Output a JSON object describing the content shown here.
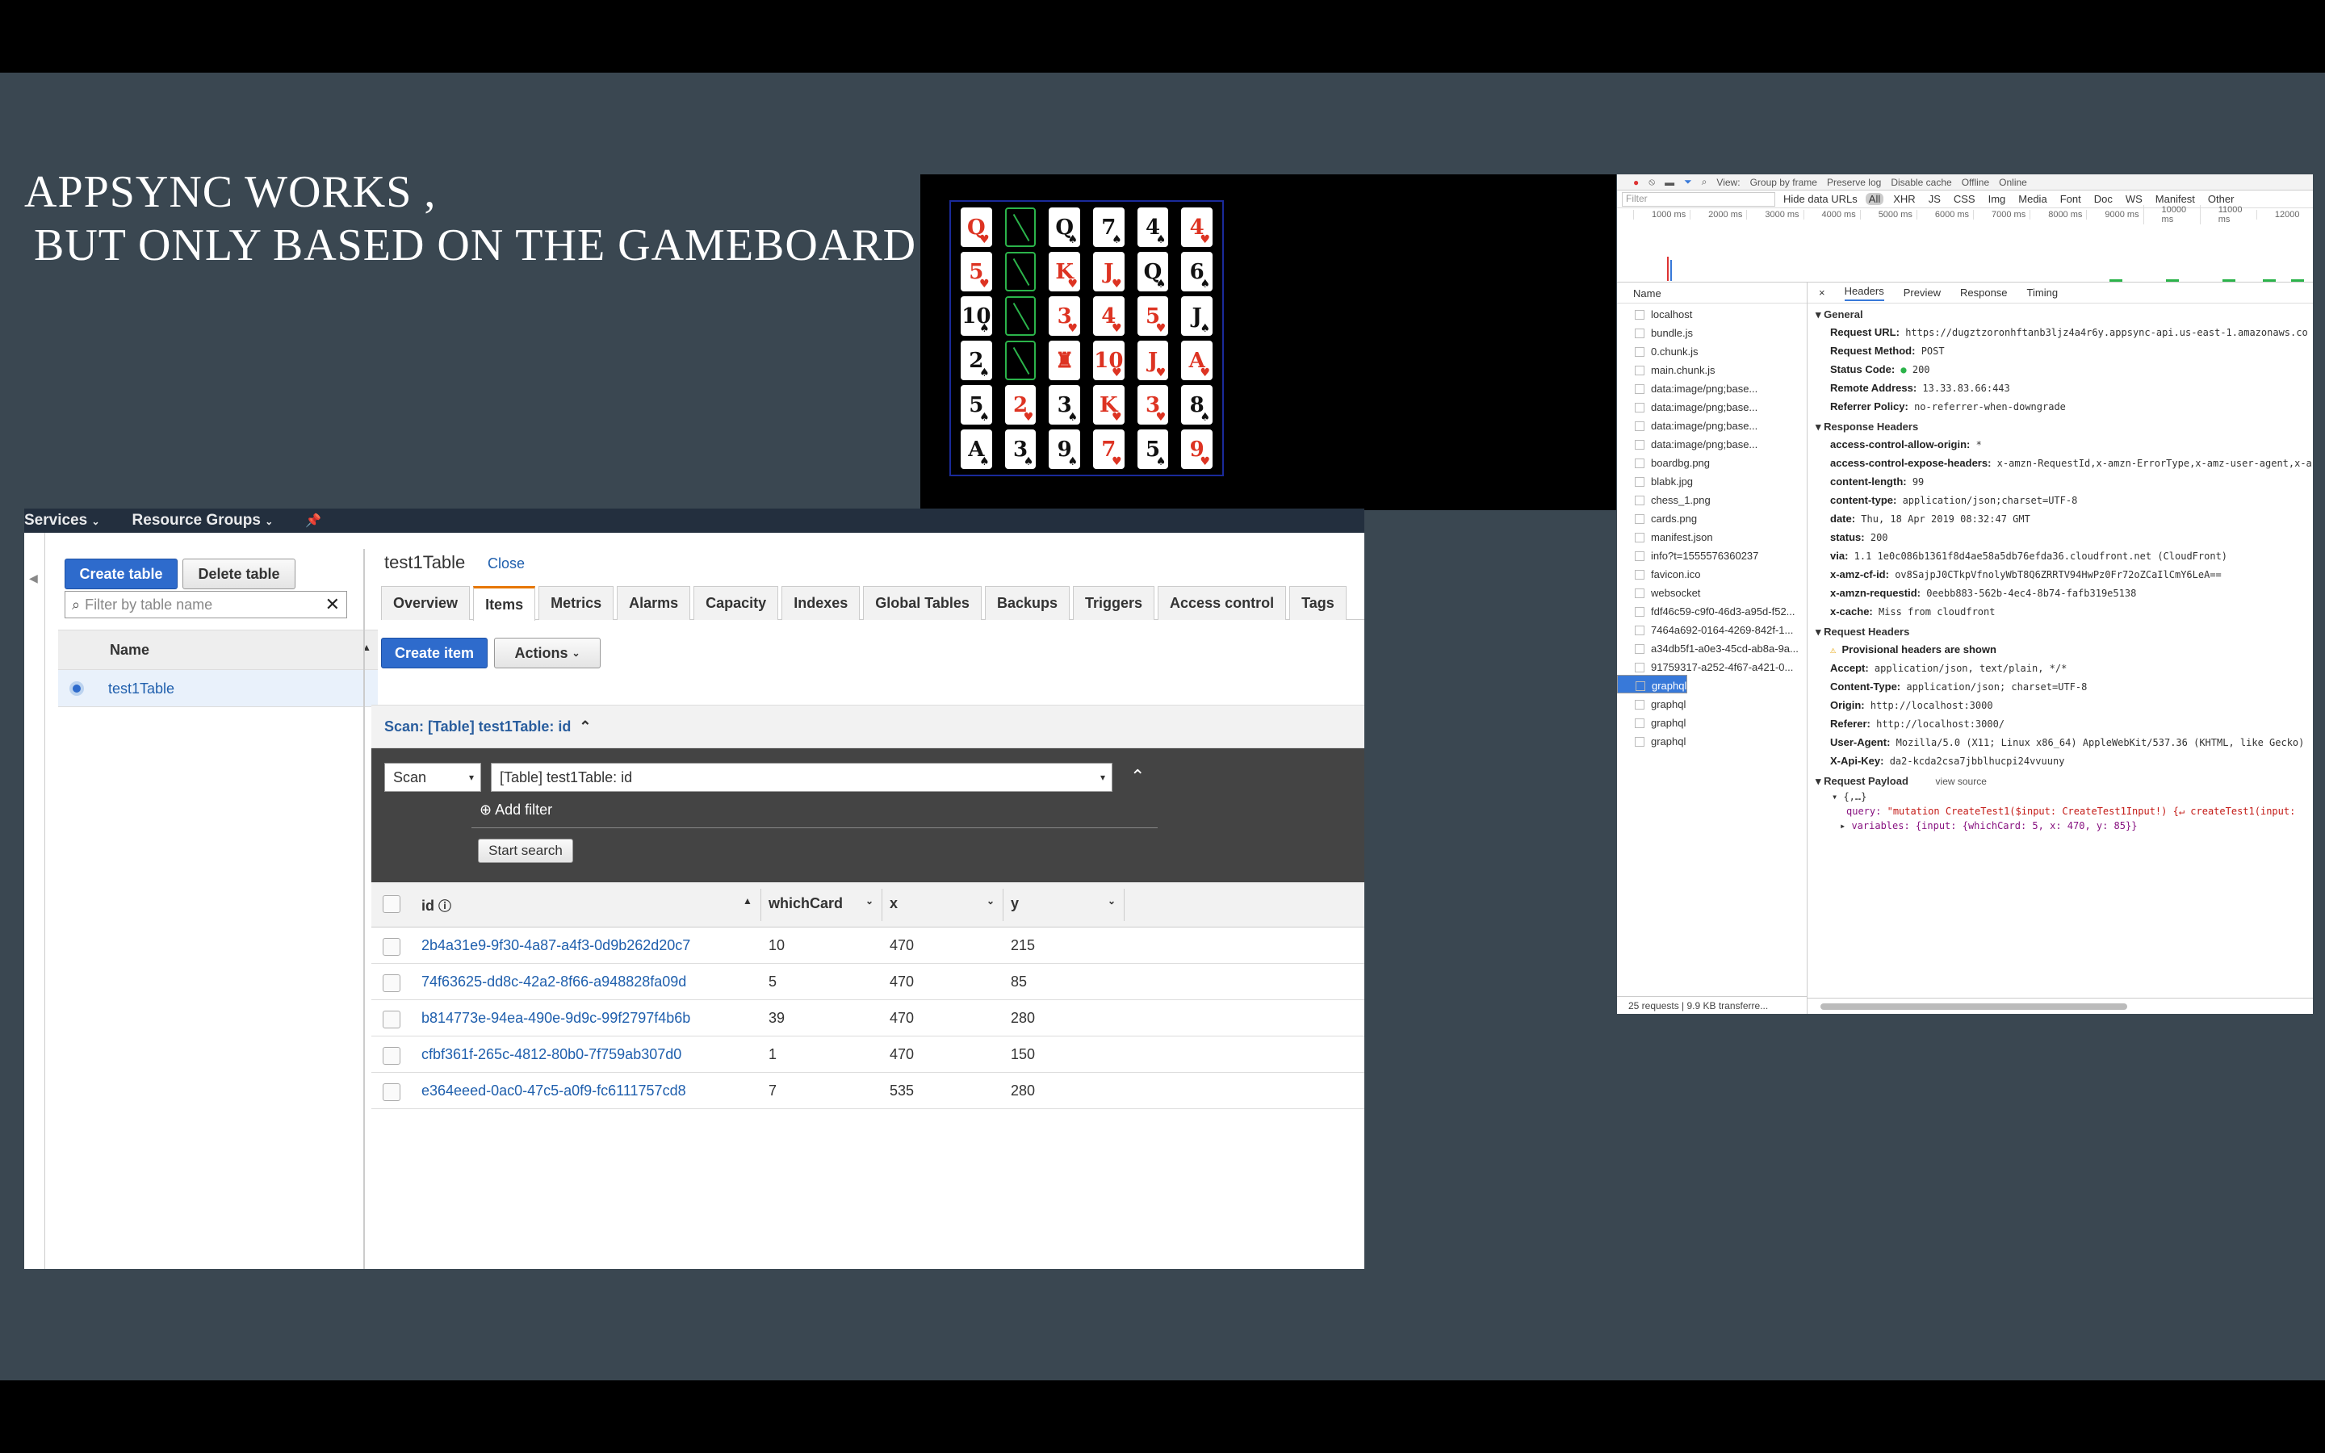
{
  "slide": {
    "title_line1": "APPSYNC WORKS ,",
    "title_line2": "BUT ONLY BASED ON THE GAMEBOARD"
  },
  "gameboard": {
    "rows": [
      [
        {
          "t": "Q",
          "c": "red",
          "s": "♥"
        },
        {
          "t": "",
          "c": "back"
        },
        {
          "t": "Q",
          "c": "black",
          "s": "♠"
        },
        {
          "t": "7",
          "c": "black",
          "s": "♠"
        },
        {
          "t": "4",
          "c": "black",
          "s": "♠"
        },
        {
          "t": "4",
          "c": "red",
          "s": "♥"
        }
      ],
      [
        {
          "t": "5",
          "c": "red",
          "s": "♥"
        },
        {
          "t": "",
          "c": "back"
        },
        {
          "t": "K",
          "c": "red",
          "s": "♥"
        },
        {
          "t": "J",
          "c": "red",
          "s": "♥"
        },
        {
          "t": "Q",
          "c": "black",
          "s": "♠"
        },
        {
          "t": "6",
          "c": "black",
          "s": "♠"
        }
      ],
      [
        {
          "t": "10",
          "c": "black",
          "s": "♠"
        },
        {
          "t": "",
          "c": "back"
        },
        {
          "t": "3",
          "c": "red",
          "s": "♥"
        },
        {
          "t": "4",
          "c": "red",
          "s": "♥"
        },
        {
          "t": "5",
          "c": "red",
          "s": "♥"
        },
        {
          "t": "J",
          "c": "black",
          "s": "♠"
        }
      ],
      [
        {
          "t": "2",
          "c": "black",
          "s": "♠"
        },
        {
          "t": "",
          "c": "back"
        },
        {
          "t": "♜",
          "c": "red",
          "s": ""
        },
        {
          "t": "10",
          "c": "red",
          "s": "♥"
        },
        {
          "t": "J",
          "c": "red",
          "s": "♥"
        },
        {
          "t": "A",
          "c": "red",
          "s": "♥"
        }
      ],
      [
        {
          "t": "5",
          "c": "black",
          "s": "♠"
        },
        {
          "t": "2",
          "c": "red",
          "s": "♥"
        },
        {
          "t": "3",
          "c": "black",
          "s": "♠"
        },
        {
          "t": "K",
          "c": "red",
          "s": "♥"
        },
        {
          "t": "3",
          "c": "red",
          "s": "♥"
        },
        {
          "t": "8",
          "c": "black",
          "s": "♠"
        }
      ],
      [
        {
          "t": "A",
          "c": "black",
          "s": "♠"
        },
        {
          "t": "3",
          "c": "black",
          "s": "♠"
        },
        {
          "t": "9",
          "c": "black",
          "s": "♠"
        },
        {
          "t": "7",
          "c": "red",
          "s": "♥"
        },
        {
          "t": "5",
          "c": "black",
          "s": "♠"
        },
        {
          "t": "9",
          "c": "red",
          "s": "♥"
        }
      ]
    ]
  },
  "devtools": {
    "toolbar": [
      "View:",
      "Group by frame",
      "Preserve log",
      "Disable cache",
      "Offline",
      "Online"
    ],
    "filter_placeholder": "Filter",
    "hide_data_urls": "Hide data URLs",
    "filter_types": [
      "All",
      "XHR",
      "JS",
      "CSS",
      "Img",
      "Media",
      "Font",
      "Doc",
      "WS",
      "Manifest",
      "Other"
    ],
    "ticks": [
      "1000 ms",
      "2000 ms",
      "3000 ms",
      "4000 ms",
      "5000 ms",
      "6000 ms",
      "7000 ms",
      "8000 ms",
      "9000 ms",
      "10000 ms",
      "11000 ms",
      "12000"
    ],
    "name_header": "Name",
    "requests": [
      "localhost",
      "bundle.js",
      "0.chunk.js",
      "main.chunk.js",
      "data:image/png;base...",
      "data:image/png;base...",
      "data:image/png;base...",
      "data:image/png;base...",
      "boardbg.png",
      "blabk.jpg",
      "chess_1.png",
      "cards.png",
      "manifest.json",
      "info?t=1555576360237",
      "favicon.ico",
      "websocket",
      "fdf46c59-c9f0-46d3-a95d-f52...",
      "7464a692-0164-4269-842f-1...",
      "a34db5f1-a0e3-45cd-ab8a-9a...",
      "91759317-a252-4f67-a421-0...",
      "graphql",
      "graphql",
      "graphql",
      "graphql",
      "graphql"
    ],
    "selected_index": 20,
    "footer": "25 requests  |  9.9 KB transferre...",
    "tabs": [
      "Headers",
      "Preview",
      "Response",
      "Timing"
    ],
    "general_title": "General",
    "general": [
      {
        "k": "Request URL:",
        "v": "https://dugztzoronhftanb3ljz4a4r6y.appsync-api.us-east-1.amazonaws.co"
      },
      {
        "k": "Request Method:",
        "v": "POST"
      },
      {
        "k": "Status Code:",
        "v": "200"
      },
      {
        "k": "Remote Address:",
        "v": "13.33.83.66:443"
      },
      {
        "k": "Referrer Policy:",
        "v": "no-referrer-when-downgrade"
      }
    ],
    "response_title": "Response Headers",
    "response": [
      {
        "k": "access-control-allow-origin:",
        "v": "*"
      },
      {
        "k": "access-control-expose-headers:",
        "v": "x-amzn-RequestId,x-amzn-ErrorType,x-amz-user-agent,x-a"
      },
      {
        "k": "content-length:",
        "v": "99"
      },
      {
        "k": "content-type:",
        "v": "application/json;charset=UTF-8"
      },
      {
        "k": "date:",
        "v": "Thu, 18 Apr 2019 08:32:47 GMT"
      },
      {
        "k": "status:",
        "v": "200"
      },
      {
        "k": "via:",
        "v": "1.1 1e0c086b1361f8d4ae58a5db76efda36.cloudfront.net (CloudFront)"
      },
      {
        "k": "x-amz-cf-id:",
        "v": "ov8SajpJ0CTkpVfnolyWbT8Q6ZRRTV94HwPz0Fr72oZCaIlCmY6LeA=="
      },
      {
        "k": "x-amzn-requestid:",
        "v": "0eebb883-562b-4ec4-8b74-fafb319e5138"
      },
      {
        "k": "x-cache:",
        "v": "Miss from cloudfront"
      }
    ],
    "request_title": "Request Headers",
    "provisional": "Provisional headers are shown",
    "request": [
      {
        "k": "Accept:",
        "v": "application/json, text/plain, */*"
      },
      {
        "k": "Content-Type:",
        "v": "application/json; charset=UTF-8"
      },
      {
        "k": "Origin:",
        "v": "http://localhost:3000"
      },
      {
        "k": "Referer:",
        "v": "http://localhost:3000/"
      },
      {
        "k": "User-Agent:",
        "v": "Mozilla/5.0 (X11; Linux x86_64) AppleWebKit/537.36 (KHTML, like Gecko)"
      },
      {
        "k": "X-Api-Key:",
        "v": "da2-kcda2csa7jbblhucpi24vvuuny"
      }
    ],
    "payload_title": "Request Payload",
    "view_source": "view source",
    "payload_root": "{,…}",
    "payload_query_key": "query:",
    "payload_query": "\"mutation CreateTest1($input: CreateTest1Input!) {↵  createTest1(input:",
    "payload_vars": "variables: {input: {whichCard: 5, x: 470, y: 85}}"
  },
  "aws": {
    "nav": [
      "Services",
      "Resource Groups"
    ],
    "create_table": "Create table",
    "delete_table": "Delete table",
    "filter_placeholder": "Filter by table name",
    "name_header": "Name",
    "table_name": "test1Table",
    "title": "test1Table",
    "close": "Close",
    "tabs": [
      "Overview",
      "Items",
      "Metrics",
      "Alarms",
      "Capacity",
      "Indexes",
      "Global Tables",
      "Backups",
      "Triggers",
      "Access control",
      "Tags"
    ],
    "create_item": "Create item",
    "actions": "Actions",
    "scan_title": "Scan: [Table] test1Table: id",
    "scan_mode": "Scan",
    "scan_target": "[Table] test1Table: id",
    "add_filter": "Add filter",
    "start_search": "Start search",
    "columns": [
      "id",
      "whichCard",
      "x",
      "y"
    ],
    "rows": [
      [
        "2b4a31e9-9f30-4a87-a4f3-0d9b262d20c7",
        "10",
        "470",
        "215"
      ],
      [
        "74f63625-dd8c-42a2-8f66-a948828fa09d",
        "5",
        "470",
        "85"
      ],
      [
        "b814773e-94ea-490e-9d9c-99f2797f4b6b",
        "39",
        "470",
        "280"
      ],
      [
        "cfbf361f-265c-4812-80b0-7f759ab307d0",
        "1",
        "470",
        "150"
      ],
      [
        "e364eeed-0ac0-47c5-a0f9-fc6111757cd8",
        "7",
        "535",
        "280"
      ]
    ]
  }
}
